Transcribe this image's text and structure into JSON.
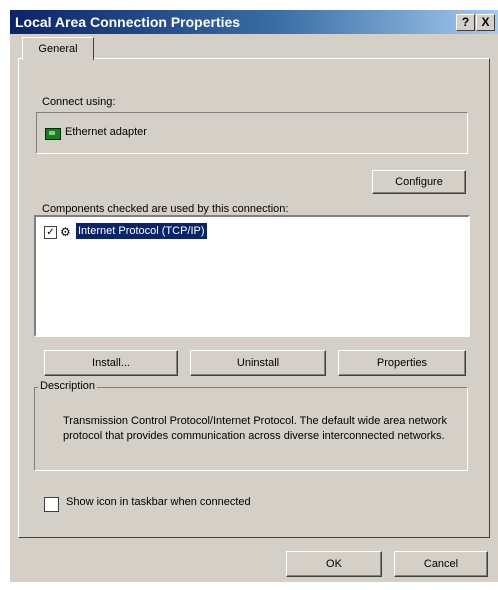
{
  "window": {
    "title": "Local Area Connection Properties",
    "help_label": "?",
    "close_label": "X"
  },
  "tabs": [
    {
      "label": "General"
    }
  ],
  "connect_using": {
    "label": "Connect using:",
    "adapter": "Ethernet adapter",
    "configure_label": "Configure"
  },
  "components": {
    "label": "Components checked are used by this connection:",
    "items": [
      {
        "label": "Internet Protocol (TCP/IP)",
        "checked": true,
        "selected": true
      }
    ]
  },
  "actions": {
    "install": "Install...",
    "uninstall": "Uninstall",
    "properties": "Properties"
  },
  "description": {
    "title": "Description",
    "text": "Transmission Control Protocol/Internet Protocol. The default wide area network protocol that provides communication across diverse interconnected networks."
  },
  "show_icon": {
    "label": "Show icon in taskbar when connected",
    "checked": false
  },
  "footer": {
    "ok": "OK",
    "cancel": "Cancel"
  },
  "colors": {
    "face": "#d4d0c8",
    "titlebar": "#0a246a",
    "selection": "#0a246a"
  }
}
